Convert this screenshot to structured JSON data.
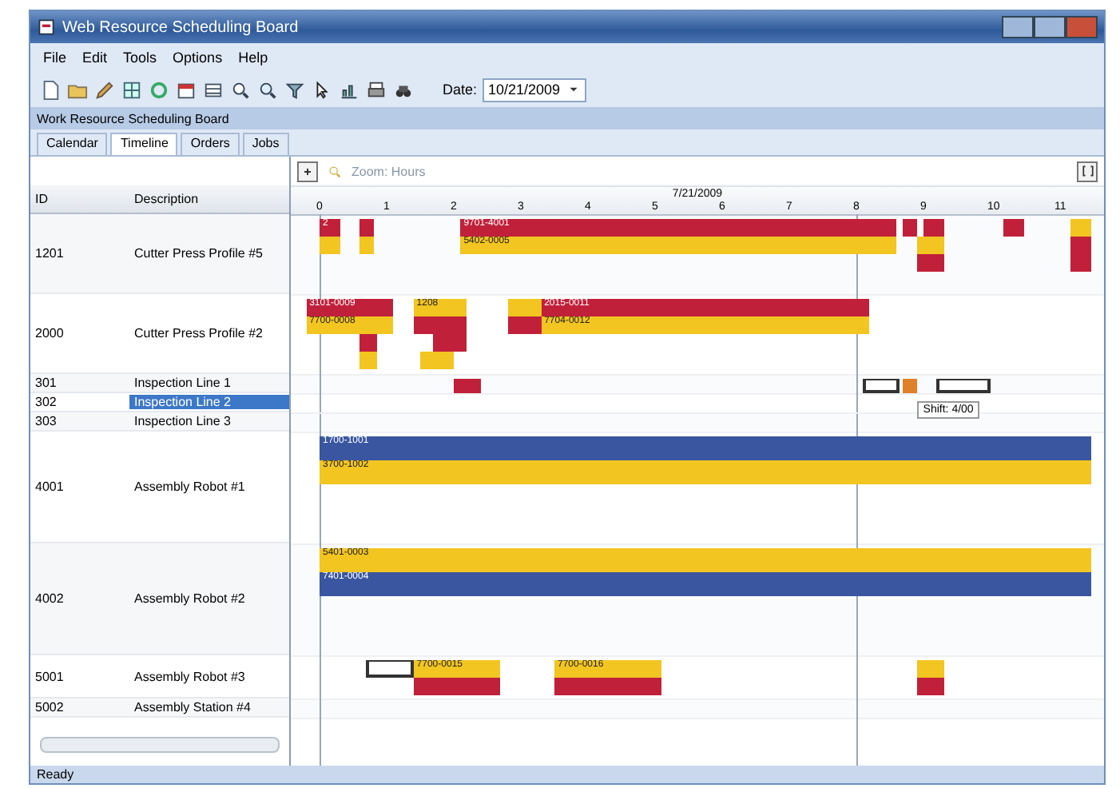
{
  "window": {
    "title": "Web Resource Scheduling Board"
  },
  "menu": [
    "File",
    "Edit",
    "Tools",
    "Options",
    "Help"
  ],
  "toolbar": {
    "date_label": "Date:",
    "date_value": "10/21/2009"
  },
  "panel": {
    "title": "Work Resource Scheduling Board"
  },
  "tabs": [
    {
      "label": "Calendar",
      "selected": false
    },
    {
      "label": "Timeline",
      "selected": true
    },
    {
      "label": "Orders",
      "selected": false
    },
    {
      "label": "Jobs",
      "selected": false
    }
  ],
  "gantt_toolbar": {
    "zoom_label": "Zoom: Hours"
  },
  "timeline": {
    "date": "7/21/2009",
    "ticks": [
      "0",
      "1",
      "2",
      "3",
      "4",
      "5",
      "6",
      "7",
      "8",
      "9",
      "10",
      "11"
    ]
  },
  "grid": {
    "columns": [
      "ID",
      "Description"
    ]
  },
  "rows": [
    {
      "id": "1201",
      "description": "Cutter Press Profile #5",
      "kind": "large",
      "selected": false,
      "bars": [
        {
          "kind": "block",
          "color": "#c0203a",
          "label": "2"
        },
        {
          "kind": "block",
          "color": "#f2c521"
        },
        {
          "kind": "block",
          "color": "#c0203a"
        },
        {
          "kind": "block",
          "color": "#f2c521"
        },
        {
          "kind": "block",
          "color": "#c0203a",
          "label": "9701-4001"
        },
        {
          "kind": "block",
          "color": "#f2c521",
          "label": "5402-0005"
        },
        {
          "kind": "block",
          "color": "#c0203a"
        },
        {
          "kind": "block",
          "color": "#c0203a"
        },
        {
          "kind": "block",
          "color": "#f2c521"
        },
        {
          "kind": "block",
          "color": "#c0203a"
        },
        {
          "kind": "block",
          "color": "#c0203a"
        },
        {
          "kind": "block",
          "color": "#f2c521"
        },
        {
          "kind": "block",
          "color": "#c0203a"
        },
        {
          "kind": "block",
          "color": "#c0203a"
        }
      ]
    },
    {
      "id": "2000",
      "description": "Cutter Press Profile #2",
      "kind": "large",
      "selected": false,
      "bars": [
        {
          "kind": "block",
          "color": "#c0203a",
          "label": "3101-0009"
        },
        {
          "kind": "block",
          "color": "#f2c521",
          "label": "7700-0008"
        },
        {
          "kind": "block",
          "color": "#c0203a"
        },
        {
          "kind": "block",
          "color": "#f2c521"
        },
        {
          "kind": "block",
          "color": "#f2c521",
          "label": "1208"
        },
        {
          "kind": "block",
          "color": "#c0203a"
        },
        {
          "kind": "block",
          "color": "#c0203a"
        },
        {
          "kind": "block",
          "color": "#f2c521"
        },
        {
          "kind": "block",
          "color": "#f2c521"
        },
        {
          "kind": "block",
          "color": "#c0203a"
        },
        {
          "kind": "block",
          "color": "#c0203a",
          "label": "2015-0011"
        },
        {
          "kind": "block",
          "color": "#f2c521",
          "label": "7704-0012"
        }
      ]
    },
    {
      "id": "301",
      "description": "Inspection Line 1",
      "kind": "small",
      "selected": false,
      "bars": [
        {
          "kind": "block",
          "color": "#c0203a"
        },
        {
          "kind": "outline"
        },
        {
          "kind": "block",
          "color": "#e0802a"
        },
        {
          "kind": "outline"
        }
      ]
    },
    {
      "id": "302",
      "description": "Inspection Line 2",
      "kind": "small",
      "selected": true,
      "tooltip": "Shift: 4/00",
      "bars": []
    },
    {
      "id": "303",
      "description": "Inspection Line 3",
      "kind": "small",
      "selected": false,
      "bars": []
    },
    {
      "id": "4001",
      "description": "Assembly Robot #1",
      "kind": "xlarge",
      "selected": false,
      "bars": [
        {
          "kind": "block",
          "color": "#3a56a0",
          "label": "1700-1001"
        },
        {
          "kind": "block",
          "color": "#f2c521",
          "label": "3700-1002"
        }
      ]
    },
    {
      "id": "4002",
      "description": "Assembly Robot #2",
      "kind": "xlarge",
      "selected": false,
      "bars": [
        {
          "kind": "block",
          "color": "#f2c521",
          "label": "5401-0003"
        },
        {
          "kind": "block",
          "color": "#3a56a0",
          "label": "7401-0004"
        }
      ]
    },
    {
      "id": "5001",
      "description": "Assembly Robot #3",
      "kind": "medium",
      "selected": false,
      "bars": [
        {
          "kind": "outline"
        },
        {
          "kind": "block",
          "color": "#f2c521",
          "label": "7700-0015"
        },
        {
          "kind": "block",
          "color": "#c0203a"
        },
        {
          "kind": "block",
          "color": "#f2c521",
          "label": "7700-0016"
        },
        {
          "kind": "block",
          "color": "#c0203a"
        },
        {
          "kind": "block",
          "color": "#f2c521"
        },
        {
          "kind": "block",
          "color": "#c0203a"
        }
      ]
    },
    {
      "id": "5002",
      "description": "Assembly Station #4",
      "kind": "small",
      "selected": false,
      "bars": []
    }
  ],
  "status_bar": {
    "text": "Ready"
  }
}
